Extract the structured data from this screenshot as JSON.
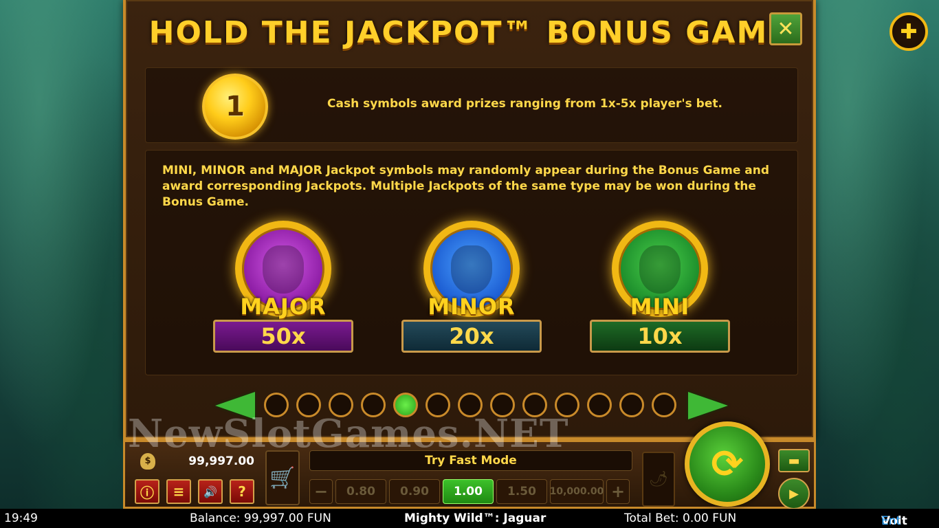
{
  "panel": {
    "title": "HOLD THE JACKPOT™ BONUS GAME",
    "close_icon": "✕"
  },
  "cash_symbol": {
    "coin_label": "1",
    "text": "Cash symbols award prizes ranging from 1x-5x player's bet."
  },
  "jackpot_info": {
    "text": "MINI, MINOR and MAJOR Jackpot symbols may randomly appear during the Bonus Game and award corresponding Jackpots. Multiple Jackpots of the same type may be won during the Bonus Game."
  },
  "jackpots": [
    {
      "name": "MAJOR",
      "value": "50x",
      "color": "#8a1aa2"
    },
    {
      "name": "MINOR",
      "value": "20x",
      "color": "#1a5ad0"
    },
    {
      "name": "MINI",
      "value": "10x",
      "color": "#1a8a2a"
    }
  ],
  "pager": {
    "pages": 13,
    "active_index": 4
  },
  "controls": {
    "balance": "99,997.00",
    "fast_mode": "Try Fast Mode",
    "bet_options": [
      "0.80",
      "0.90",
      "1.00",
      "1.50",
      "10,000.00"
    ],
    "selected_bet": "1.00",
    "minus": "−",
    "plus": "+",
    "buttons": {
      "info": "ⓘ",
      "menu": "≡",
      "sound": "🔊",
      "help": "?"
    }
  },
  "watermark": "NewSlotGames.NET",
  "statusbar": {
    "time": "19:49",
    "balance": "Balance: 99,997.00 FUN",
    "game_title": "Mighty Wild™: Jaguar",
    "total_bet": "Total Bet: 0.00 FUN",
    "brand_volt": "Volt",
    "brand_ent": "Ent"
  }
}
